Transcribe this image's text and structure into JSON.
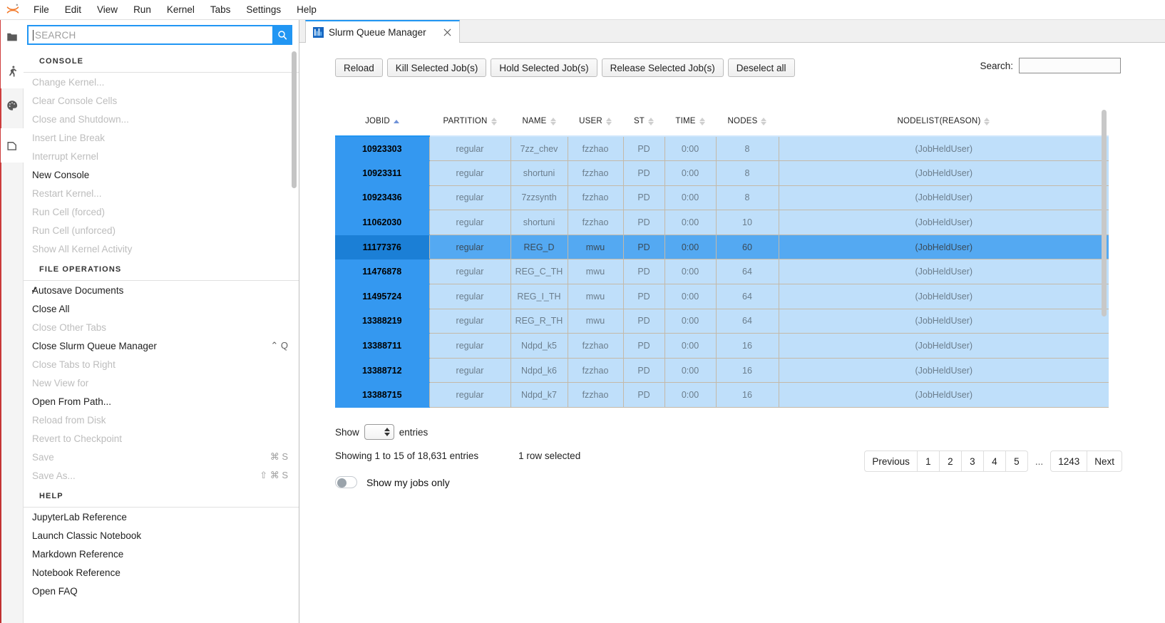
{
  "menubar": {
    "logo_icon": "jupyter-logo-icon",
    "items": [
      "File",
      "Edit",
      "View",
      "Run",
      "Kernel",
      "Tabs",
      "Settings",
      "Help"
    ]
  },
  "rail": {
    "items": [
      {
        "name": "file-browser-icon",
        "selected": true
      },
      {
        "name": "running-sessions-icon",
        "selected": true
      },
      {
        "name": "palette-icon",
        "selected": false
      },
      {
        "name": "extension-manager-icon",
        "selected": true
      }
    ]
  },
  "palette": {
    "search": {
      "value": "",
      "placeholder": "SEARCH",
      "icon": "search-icon"
    },
    "sections": [
      {
        "heading": "CONSOLE",
        "commands": [
          {
            "label": "Change Kernel...",
            "enabled": false,
            "shortcut": "",
            "checked": false
          },
          {
            "label": "Clear Console Cells",
            "enabled": false,
            "shortcut": "",
            "checked": false
          },
          {
            "label": "Close and Shutdown...",
            "enabled": false,
            "shortcut": "",
            "checked": false
          },
          {
            "label": "Insert Line Break",
            "enabled": false,
            "shortcut": "",
            "checked": false
          },
          {
            "label": "Interrupt Kernel",
            "enabled": false,
            "shortcut": "",
            "checked": false
          },
          {
            "label": "New Console",
            "enabled": true,
            "shortcut": "",
            "checked": false
          },
          {
            "label": "Restart Kernel...",
            "enabled": false,
            "shortcut": "",
            "checked": false
          },
          {
            "label": "Run Cell (forced)",
            "enabled": false,
            "shortcut": "",
            "checked": false
          },
          {
            "label": "Run Cell (unforced)",
            "enabled": false,
            "shortcut": "",
            "checked": false
          },
          {
            "label": "Show All Kernel Activity",
            "enabled": false,
            "shortcut": "",
            "checked": false
          }
        ]
      },
      {
        "heading": "FILE OPERATIONS",
        "commands": [
          {
            "label": "Autosave Documents",
            "enabled": true,
            "shortcut": "",
            "checked": true
          },
          {
            "label": "Close All",
            "enabled": true,
            "shortcut": "",
            "checked": false
          },
          {
            "label": "Close Other Tabs",
            "enabled": false,
            "shortcut": "",
            "checked": false
          },
          {
            "label": "Close Slurm Queue Manager",
            "enabled": true,
            "shortcut": "⌃ Q",
            "checked": false
          },
          {
            "label": "Close Tabs to Right",
            "enabled": false,
            "shortcut": "",
            "checked": false
          },
          {
            "label": "New View for",
            "enabled": false,
            "shortcut": "",
            "checked": false
          },
          {
            "label": "Open From Path...",
            "enabled": true,
            "shortcut": "",
            "checked": false
          },
          {
            "label": "Reload from Disk",
            "enabled": false,
            "shortcut": "",
            "checked": false
          },
          {
            "label": "Revert to Checkpoint",
            "enabled": false,
            "shortcut": "",
            "checked": false
          },
          {
            "label": "Save",
            "enabled": false,
            "shortcut": "⌘ S",
            "checked": false
          },
          {
            "label": "Save As...",
            "enabled": false,
            "shortcut": "⇧ ⌘ S",
            "checked": false
          }
        ]
      },
      {
        "heading": "HELP",
        "commands": [
          {
            "label": "JupyterLab Reference",
            "enabled": true,
            "shortcut": "",
            "checked": false
          },
          {
            "label": "Launch Classic Notebook",
            "enabled": true,
            "shortcut": "",
            "checked": false
          },
          {
            "label": "Markdown Reference",
            "enabled": true,
            "shortcut": "",
            "checked": false
          },
          {
            "label": "Notebook Reference",
            "enabled": true,
            "shortcut": "",
            "checked": false
          },
          {
            "label": "Open FAQ",
            "enabled": true,
            "shortcut": "",
            "checked": false
          }
        ]
      }
    ]
  },
  "tab": {
    "title": "Slurm Queue Manager",
    "icon": "slurm-app-icon",
    "close_icon": "close-icon"
  },
  "toolbar": {
    "buttons": [
      "Reload",
      "Kill Selected Job(s)",
      "Hold Selected Job(s)",
      "Release Selected Job(s)",
      "Deselect all"
    ]
  },
  "table_search": {
    "label": "Search:",
    "value": "",
    "placeholder": ""
  },
  "table": {
    "columns": [
      {
        "label": "JOBID",
        "sort": "asc"
      },
      {
        "label": "PARTITION",
        "sort": "none"
      },
      {
        "label": "NAME",
        "sort": "none"
      },
      {
        "label": "USER",
        "sort": "none"
      },
      {
        "label": "ST",
        "sort": "none"
      },
      {
        "label": "TIME",
        "sort": "none"
      },
      {
        "label": "NODES",
        "sort": "none"
      },
      {
        "label": "NODELIST(REASON)",
        "sort": "none"
      }
    ],
    "rows": [
      {
        "jobid": "10923303",
        "partition": "regular",
        "name": "7zz_chev",
        "user": "fzzhao",
        "st": "PD",
        "time": "0:00",
        "nodes": "8",
        "nodelist": "(JobHeldUser)",
        "selected": false
      },
      {
        "jobid": "10923311",
        "partition": "regular",
        "name": "shortuni",
        "user": "fzzhao",
        "st": "PD",
        "time": "0:00",
        "nodes": "8",
        "nodelist": "(JobHeldUser)",
        "selected": false
      },
      {
        "jobid": "10923436",
        "partition": "regular",
        "name": "7zzsynth",
        "user": "fzzhao",
        "st": "PD",
        "time": "0:00",
        "nodes": "8",
        "nodelist": "(JobHeldUser)",
        "selected": false
      },
      {
        "jobid": "11062030",
        "partition": "regular",
        "name": "shortuni",
        "user": "fzzhao",
        "st": "PD",
        "time": "0:00",
        "nodes": "10",
        "nodelist": "(JobHeldUser)",
        "selected": false
      },
      {
        "jobid": "11177376",
        "partition": "regular",
        "name": "REG_D",
        "user": "mwu",
        "st": "PD",
        "time": "0:00",
        "nodes": "60",
        "nodelist": "(JobHeldUser)",
        "selected": true
      },
      {
        "jobid": "11476878",
        "partition": "regular",
        "name": "REG_C_TH",
        "user": "mwu",
        "st": "PD",
        "time": "0:00",
        "nodes": "64",
        "nodelist": "(JobHeldUser)",
        "selected": false
      },
      {
        "jobid": "11495724",
        "partition": "regular",
        "name": "REG_I_TH",
        "user": "mwu",
        "st": "PD",
        "time": "0:00",
        "nodes": "64",
        "nodelist": "(JobHeldUser)",
        "selected": false
      },
      {
        "jobid": "13388219",
        "partition": "regular",
        "name": "REG_R_TH",
        "user": "mwu",
        "st": "PD",
        "time": "0:00",
        "nodes": "64",
        "nodelist": "(JobHeldUser)",
        "selected": false
      },
      {
        "jobid": "13388711",
        "partition": "regular",
        "name": "Ndpd_k5",
        "user": "fzzhao",
        "st": "PD",
        "time": "0:00",
        "nodes": "16",
        "nodelist": "(JobHeldUser)",
        "selected": false
      },
      {
        "jobid": "13388712",
        "partition": "regular",
        "name": "Ndpd_k6",
        "user": "fzzhao",
        "st": "PD",
        "time": "0:00",
        "nodes": "16",
        "nodelist": "(JobHeldUser)",
        "selected": false
      },
      {
        "jobid": "13388715",
        "partition": "regular",
        "name": "Ndpd_k7",
        "user": "fzzhao",
        "st": "PD",
        "time": "0:00",
        "nodes": "16",
        "nodelist": "(JobHeldUser)",
        "selected": false
      }
    ]
  },
  "footer": {
    "show_label": "Show",
    "entries_label": "entries",
    "page_size_value": "",
    "showing_text": "Showing 1 to 15 of 18,631 entries",
    "selected_text": "1 row selected",
    "toggle_label": "Show my jobs only",
    "toggle_on": false,
    "pagination": {
      "previous": "Previous",
      "pages": [
        "1",
        "2",
        "3",
        "4",
        "5"
      ],
      "ellipsis": "...",
      "last": "1243",
      "next": "Next"
    }
  },
  "colors": {
    "accent": "#2196f3",
    "row_bg": "#bfdffa",
    "jobid_bg": "#3498f0",
    "selected_row_bg": "#54a9f2",
    "selected_jobid_bg": "#1b7fd6"
  }
}
